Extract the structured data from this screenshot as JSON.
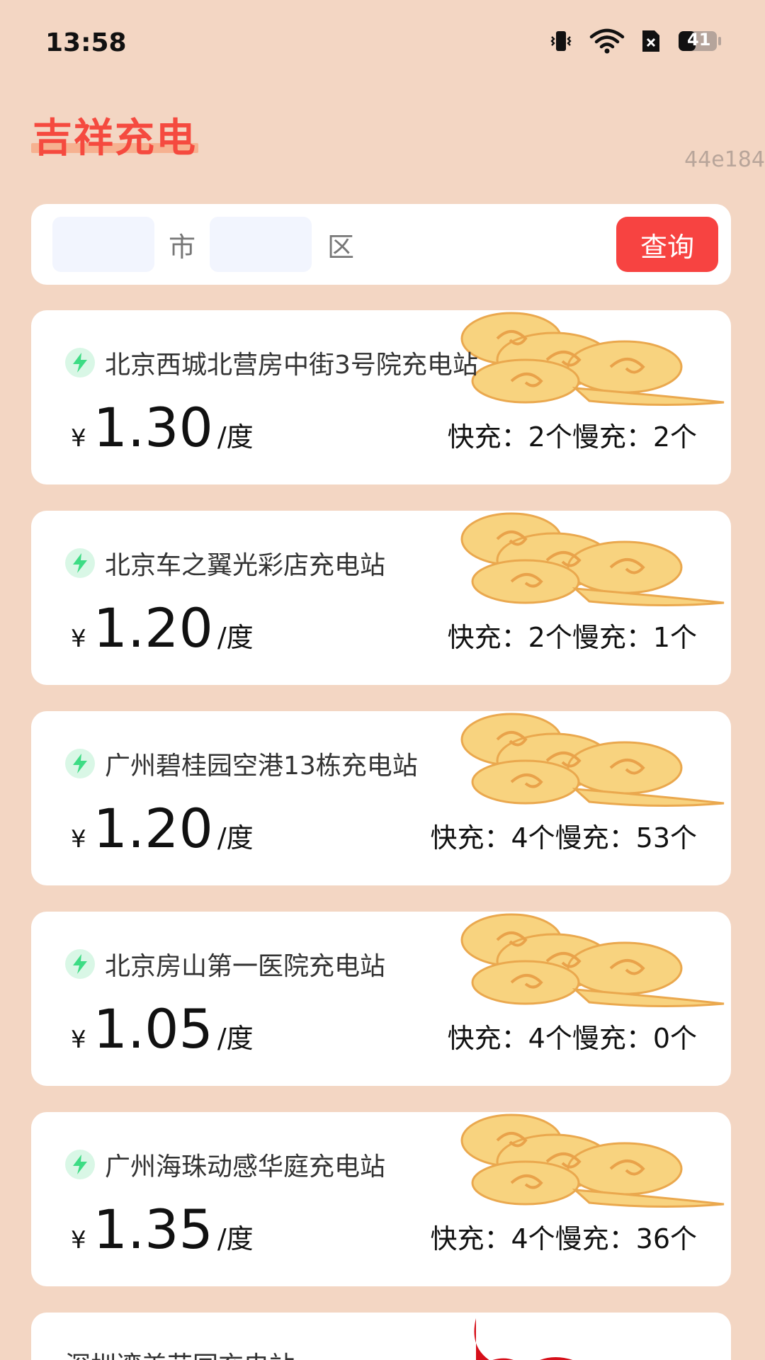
{
  "status_bar": {
    "time": "13:58",
    "battery": "41",
    "icons": [
      "vibrate-icon",
      "wifi-icon",
      "sim-off-icon",
      "battery-icon"
    ]
  },
  "header": {
    "title": "吉祥充电",
    "build_id": "44e184"
  },
  "search": {
    "city_value": "",
    "city_unit": "市",
    "district_value": "",
    "district_unit": "区",
    "query_label": "查询"
  },
  "stations": [
    {
      "name": "北京西城北营房中街3号院充电站",
      "currency": "¥",
      "price": "1.30",
      "unit": "/度",
      "chargers": "快充：2个慢充：2个"
    },
    {
      "name": "北京车之翼光彩店充电站",
      "currency": "¥",
      "price": "1.20",
      "unit": "/度",
      "chargers": "快充：2个慢充：1个"
    },
    {
      "name": "广州碧桂园空港13栋充电站",
      "currency": "¥",
      "price": "1.20",
      "unit": "/度",
      "chargers": "快充：4个慢充：53个"
    },
    {
      "name": "北京房山第一医院充电站",
      "currency": "¥",
      "price": "1.05",
      "unit": "/度",
      "chargers": "快充：4个慢充：0个"
    },
    {
      "name": "广州海珠动感华庭充电站",
      "currency": "¥",
      "price": "1.35",
      "unit": "/度",
      "chargers": "快充：4个慢充：36个"
    },
    {
      "name": "深圳湾美花园充电站"
    }
  ],
  "colors": {
    "background": "#f3d6c3",
    "title": "#f54a3f",
    "query_button": "#f74341",
    "input_bg": "#f2f5fe",
    "bolt": "#3ddc84",
    "cloud": "#f6c46a"
  }
}
